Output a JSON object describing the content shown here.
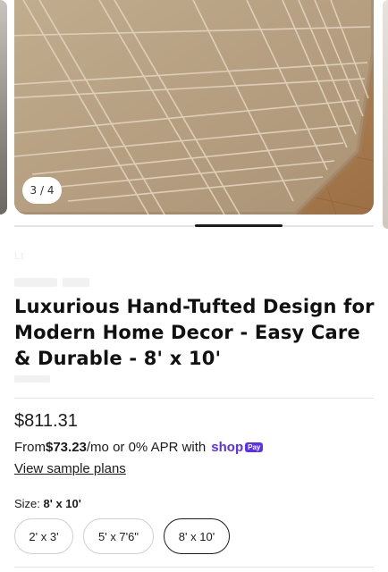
{
  "gallery": {
    "counter": "3 / 4",
    "image_description_icon": "rug-photo"
  },
  "product": {
    "vendor_faint": "Lt",
    "title": "Luxurious Hand-Tufted Design for Modern Home Decor - Easy Care & Durable - 8' x 10'",
    "price": "$811.31",
    "installments": {
      "prefix": "From ",
      "amount": "$73.23",
      "suffix": "/mo or 0% APR with",
      "brand_word": "shop",
      "brand_badge": "Pay"
    },
    "sample_plans_link": "View sample plans"
  },
  "size": {
    "label": "Size:",
    "selected": "8' x 10'",
    "options": [
      "2' x 3'",
      "5' x 7'6\"",
      "8' x 10'"
    ]
  },
  "colors": {
    "brand_purple": "#5a31f4",
    "rug": "#b8a386",
    "text": "#1c1c1c"
  }
}
